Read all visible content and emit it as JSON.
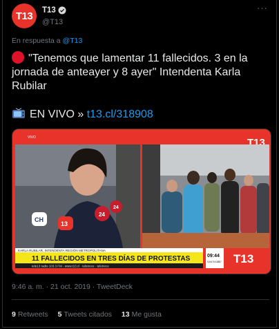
{
  "author": {
    "avatar_text": "T13",
    "name": "T13",
    "handle": "@T13"
  },
  "reply": {
    "prefix": "En respuesta a",
    "to": "@T13"
  },
  "tweet": {
    "text": "\"Tenemos que lamentar 11 fallecidos. 3 en la jornada de anteayer y 8 ayer\" Intendenta Karla Rubilar",
    "live_label": "EN VIVO »",
    "link": "t13.cl/318908"
  },
  "media": {
    "tag_live": "VIVO",
    "logo": "T13",
    "caption_top": "KARLA RUBILAR, INTENDENTA REGIÓN METROPOLITANA",
    "headline": "11 FALLECIDOS EN TRES DÍAS DE PROTESTAS",
    "ticker": "tele13 radio 103.3 FM  ·  www.t13.cl  ·  teletrece  ·  teletrece",
    "time": "09:44",
    "location": "SANTIAGO",
    "temp": "26°",
    "mic_labels": [
      "CH",
      "13",
      "24",
      "24"
    ]
  },
  "meta": {
    "time": "9:46 a. m.",
    "date": "21 oct. 2019",
    "source": "TweetDeck",
    "sep": "·"
  },
  "stats": [
    {
      "count": "9",
      "label": "Retweets"
    },
    {
      "count": "5",
      "label": "Tweets citados"
    },
    {
      "count": "13",
      "label": "Me gusta"
    }
  ],
  "colors": {
    "brand": "#e8332a",
    "link": "#1d9bf0",
    "muted": "#71767b",
    "headline_bar": "#f5e61a"
  }
}
